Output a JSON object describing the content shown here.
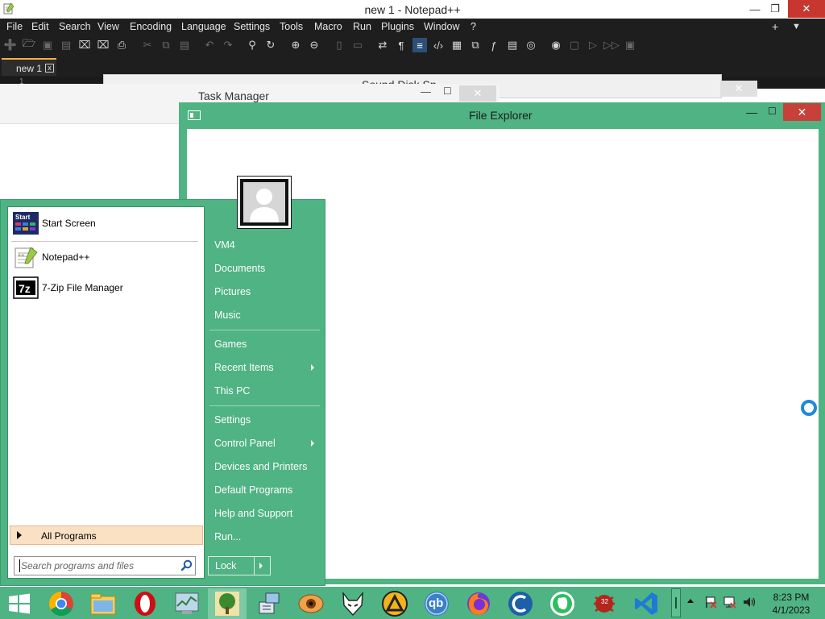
{
  "notepad": {
    "title": "new 1 - Notepad++",
    "controls": {
      "minimize": "—",
      "maximize": "❐",
      "close": "✕"
    },
    "menu": [
      "File",
      "Edit",
      "Search",
      "View",
      "Encoding",
      "Language",
      "Settings",
      "Tools",
      "Macro",
      "Run",
      "Plugins",
      "Window",
      "?"
    ],
    "menu_right": {
      "plus": "+",
      "dropdown": "▼"
    },
    "tab": {
      "label": "new 1",
      "close": "x"
    },
    "line_number": "1"
  },
  "sound_window": {
    "title": "Sound Disk Sp",
    "close": "✕"
  },
  "task_manager": {
    "title": "Task Manager",
    "minimize": "—",
    "maximize": "☐",
    "close": "✕"
  },
  "file_explorer": {
    "title": "File Explorer",
    "minimize": "—",
    "maximize": "☐",
    "close": "✕"
  },
  "start_menu": {
    "pinned": [
      {
        "label": "Start Screen",
        "icon": "start-screen-icon"
      },
      {
        "label": "Notepad++",
        "icon": "notepadpp-icon"
      },
      {
        "label": "7-Zip File Manager",
        "icon": "7zip-icon"
      }
    ],
    "all_programs": "All Programs",
    "search_placeholder": "Search programs and files",
    "right_items": {
      "vm4": "VM4",
      "documents": "Documents",
      "pictures": "Pictures",
      "music": "Music",
      "games": "Games",
      "recent_items": "Recent Items",
      "this_pc": "This PC",
      "settings": "Settings",
      "control_panel": "Control Panel",
      "devices_printers": "Devices and Printers",
      "default_programs": "Default Programs",
      "help_support": "Help and Support",
      "run": "Run..."
    },
    "lock": "Lock"
  },
  "taskbar": {
    "apps": [
      "windows-start-icon",
      "chrome-icon",
      "file-explorer-icon",
      "opera-icon",
      "task-manager-icon",
      "tree-app-icon",
      "network-setup-icon",
      "eye-app-icon",
      "fox-app-icon",
      "aimp-icon",
      "qbittorrent-icon",
      "firefox-icon",
      "ccleaner-icon",
      "evernote-icon",
      "bug-app-icon",
      "vscode-icon"
    ],
    "qb_label": "qb",
    "badge": "32",
    "clock": {
      "time": "8:23 PM",
      "date": "4/1/2023"
    }
  },
  "colors": {
    "accent": "#4fb383",
    "close_red": "#c7403a",
    "npp_dark": "#1e1e1e",
    "tab_highlight": "#f2b33d",
    "all_programs_bg": "#fae1c4"
  }
}
